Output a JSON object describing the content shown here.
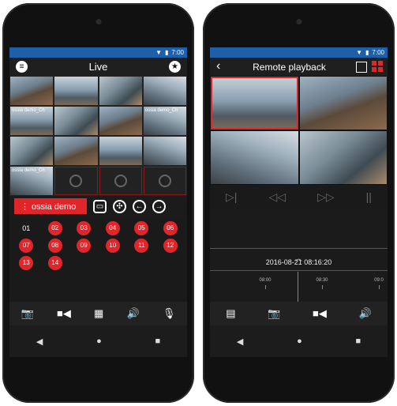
{
  "left_phone": {
    "status": {
      "time": "7:00"
    },
    "title": "Live",
    "menu_icon": "menu-icon",
    "favorite_icon": "star-icon",
    "camera_labels": [
      "",
      "",
      "",
      "",
      "ossia demo_Ch",
      "",
      "",
      "ossia demo_Ch",
      "",
      "",
      "",
      "",
      "ossia demo_Ch",
      "",
      "",
      ""
    ],
    "selected_device": "⋮ ossia demo",
    "channels": [
      "01",
      "02",
      "03",
      "04",
      "05",
      "06",
      "07",
      "08",
      "09",
      "10",
      "11",
      "12",
      "13",
      "14"
    ],
    "bottom_icons": [
      "camera-icon",
      "video-icon",
      "grid-icon",
      "speaker-icon",
      "microphone-icon"
    ]
  },
  "right_phone": {
    "status": {
      "time": "7:00"
    },
    "title": "Remote playback",
    "timestamp": "2016-08-21 08:16:20",
    "ticks": [
      "08:00",
      "08:30",
      "09:0"
    ],
    "bottom_icons": [
      "playback-icon",
      "camera-icon",
      "video-icon",
      "speaker-icon"
    ]
  },
  "colors": {
    "accent": "#e0262b",
    "status_bar": "#1d5fa8",
    "rec_yellow": "#d9c02a",
    "rec_blue": "#2f58b8"
  }
}
